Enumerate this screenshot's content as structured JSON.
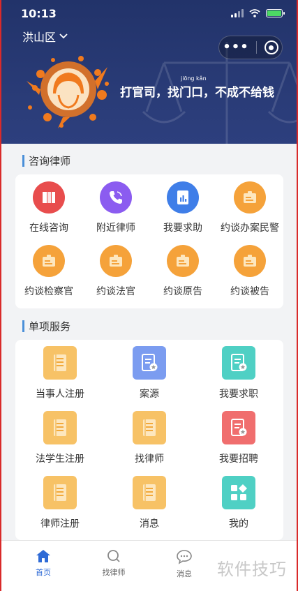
{
  "status_bar": {
    "time": "10:13"
  },
  "header": {
    "location": "洪山区",
    "slogan": "打官司，找门口，不成不给钱",
    "pinyin": "jiōng kǎn"
  },
  "consult": {
    "title": "咨询律师",
    "items": [
      {
        "label": "在线咨询",
        "icon": "books-icon",
        "color": "#e84d4d"
      },
      {
        "label": "附近律师",
        "icon": "phone-icon",
        "color": "#8b5cf0"
      },
      {
        "label": "我要求助",
        "icon": "chart-doc-icon",
        "color": "#3f7ee8"
      },
      {
        "label": "约谈办案民警",
        "icon": "case-card-icon",
        "color": "#f5a23a"
      },
      {
        "label": "约谈检察官",
        "icon": "case-card-icon",
        "color": "#f5a23a"
      },
      {
        "label": "约谈法官",
        "icon": "case-card-icon",
        "color": "#f5a23a"
      },
      {
        "label": "约谈原告",
        "icon": "case-card-icon",
        "color": "#f5a23a"
      },
      {
        "label": "约谈被告",
        "icon": "case-card-icon",
        "color": "#f5a23a"
      }
    ]
  },
  "services": {
    "title": "单项服务",
    "items": [
      {
        "label": "当事人注册",
        "icon": "document-icon",
        "color": "#f7c266"
      },
      {
        "label": "案源",
        "icon": "document-star-icon",
        "color": "#7b9cf0"
      },
      {
        "label": "我要求职",
        "icon": "document-star-icon",
        "color": "#4fd0c4"
      },
      {
        "label": "法学生注册",
        "icon": "document-icon",
        "color": "#f7c266"
      },
      {
        "label": "找律师",
        "icon": "document-icon",
        "color": "#f7c266"
      },
      {
        "label": "我要招聘",
        "icon": "document-star-icon",
        "color": "#f06e6e"
      },
      {
        "label": "律师注册",
        "icon": "document-icon",
        "color": "#f7c266"
      },
      {
        "label": "消息",
        "icon": "document-icon",
        "color": "#f7c266"
      },
      {
        "label": "我的",
        "icon": "grid-apps-icon",
        "color": "#4fd0c4"
      }
    ]
  },
  "tabbar": {
    "tabs": [
      {
        "label": "首页",
        "icon": "home-icon",
        "active": true
      },
      {
        "label": "找律师",
        "icon": "search-icon",
        "active": false
      },
      {
        "label": "消息",
        "icon": "chat-icon",
        "active": false
      }
    ]
  },
  "watermark": "软件技巧"
}
